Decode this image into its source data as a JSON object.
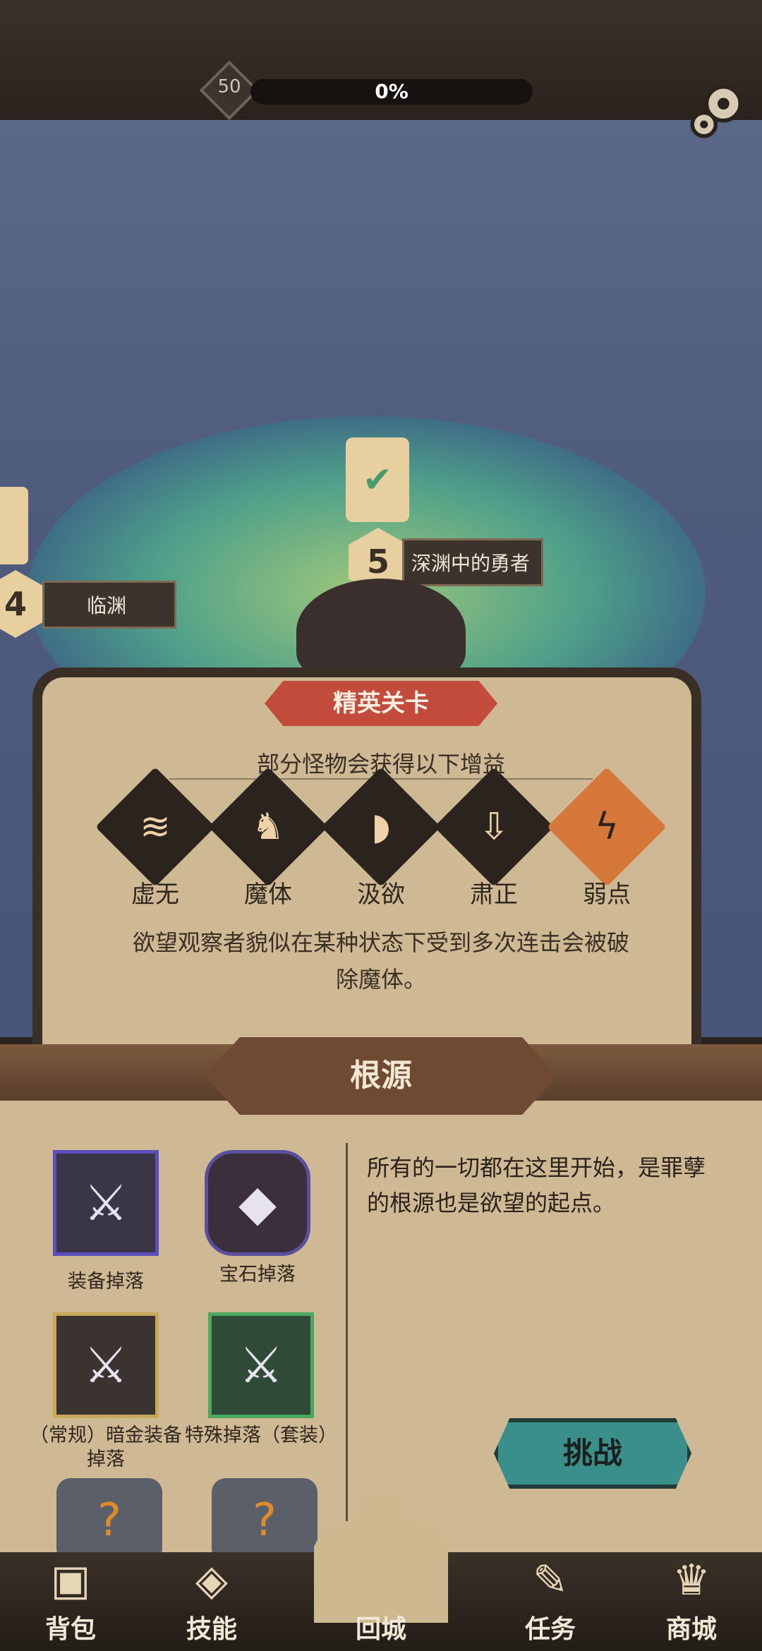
{
  "hud": {
    "level": "50",
    "exp_percent": "0%"
  },
  "map_nodes": [
    {
      "number": "4",
      "name": "临渊"
    },
    {
      "number": "5",
      "name": "深渊中的勇者"
    }
  ],
  "elite": {
    "tag": "精英关卡",
    "subtitle": "部分怪物会获得以下增益",
    "buffs": [
      {
        "label": "虚无",
        "icon": "void-icon"
      },
      {
        "label": "魔体",
        "icon": "demon-body-icon"
      },
      {
        "label": "汲欲",
        "icon": "drain-desire-icon"
      },
      {
        "label": "肃正",
        "icon": "purge-icon"
      },
      {
        "label": "弱点",
        "icon": "weakness-icon"
      }
    ],
    "description": "欲望观察者貌似在某种状态下受到多次连击会被破除魔体。"
  },
  "origin": {
    "title": "根源",
    "description": "所有的一切都在这里开始，是罪孽的根源也是欲望的起点。",
    "drops": [
      {
        "label": "装备掉落",
        "icon": "equipment-drop-icon"
      },
      {
        "label": "宝石掉落",
        "icon": "gem-drop-icon"
      },
      {
        "label": "（常规）暗金装备掉落",
        "icon": "dark-gold-equipment-icon"
      },
      {
        "label": "特殊掉落（套装）",
        "icon": "set-equipment-icon"
      }
    ],
    "challenge_label": "挑战"
  },
  "nav": [
    {
      "label": "背包",
      "icon": "backpack-icon"
    },
    {
      "label": "技能",
      "icon": "skill-icon"
    },
    {
      "label": "回城",
      "icon": "castle-icon"
    },
    {
      "label": "任务",
      "icon": "quest-icon"
    },
    {
      "label": "商城",
      "icon": "shop-icon"
    }
  ]
}
